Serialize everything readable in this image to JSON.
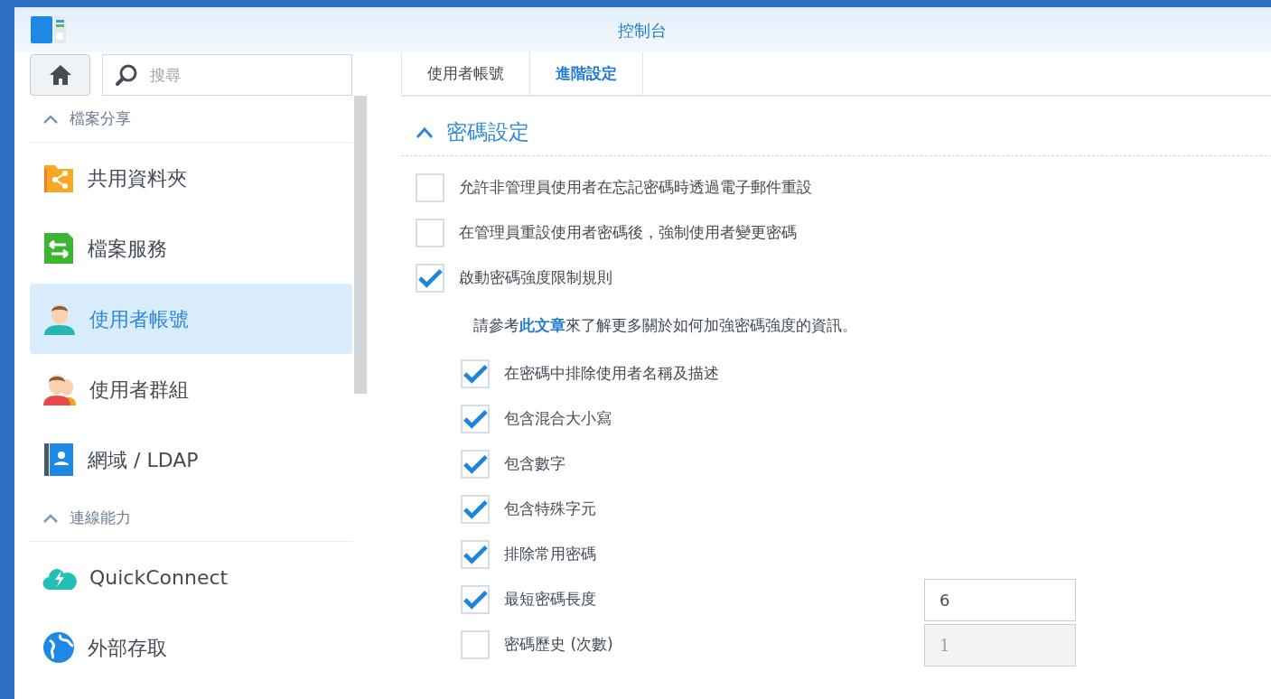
{
  "window": {
    "title": "控制台"
  },
  "sidebar": {
    "search": {
      "placeholder": "搜尋"
    },
    "items": [
      {
        "kind": "section",
        "label": "檔案分享",
        "expanded": true
      },
      {
        "kind": "item",
        "label": "共用資料夾",
        "selected": false
      },
      {
        "kind": "item",
        "label": "檔案服務",
        "selected": false
      },
      {
        "kind": "item",
        "label": "使用者帳號",
        "selected": true
      },
      {
        "kind": "item",
        "label": "使用者群組",
        "selected": false
      },
      {
        "kind": "item",
        "label": "網域 / LDAP",
        "selected": false
      },
      {
        "kind": "section",
        "label": "連線能力",
        "expanded": true
      },
      {
        "kind": "item",
        "label": "QuickConnect",
        "selected": false
      },
      {
        "kind": "item",
        "label": "外部存取",
        "selected": false
      }
    ]
  },
  "tabs": [
    {
      "label": "使用者帳號",
      "selected": false
    },
    {
      "label": "進階設定",
      "selected": true
    }
  ],
  "panel": {
    "title": "密碼設定",
    "expanded": true,
    "options": [
      {
        "label": "允許非管理員使用者在忘記密碼時透過電子郵件重設",
        "checked": false
      },
      {
        "label": "在管理員重設使用者密碼後，強制使用者變更密碼",
        "checked": false
      },
      {
        "label": "啟動密碼強度限制規則",
        "checked": true,
        "note": {
          "before": "請參考",
          "link": "此文章",
          "after": "來了解更多關於如何加強密碼強度的資訊。"
        },
        "children": [
          {
            "label": "在密碼中排除使用者名稱及描述",
            "checked": true
          },
          {
            "label": "包含混合大小寫",
            "checked": true
          },
          {
            "label": "包含數字",
            "checked": true
          },
          {
            "label": "包含特殊字元",
            "checked": true
          },
          {
            "label": "排除常用密碼",
            "checked": true
          },
          {
            "label": "最短密碼長度",
            "checked": true,
            "field": {
              "value": "6",
              "disabled": false
            }
          },
          {
            "label": "密碼歷史 (次數)",
            "checked": false,
            "field": {
              "value": "1",
              "disabled": true
            }
          }
        ]
      }
    ]
  }
}
